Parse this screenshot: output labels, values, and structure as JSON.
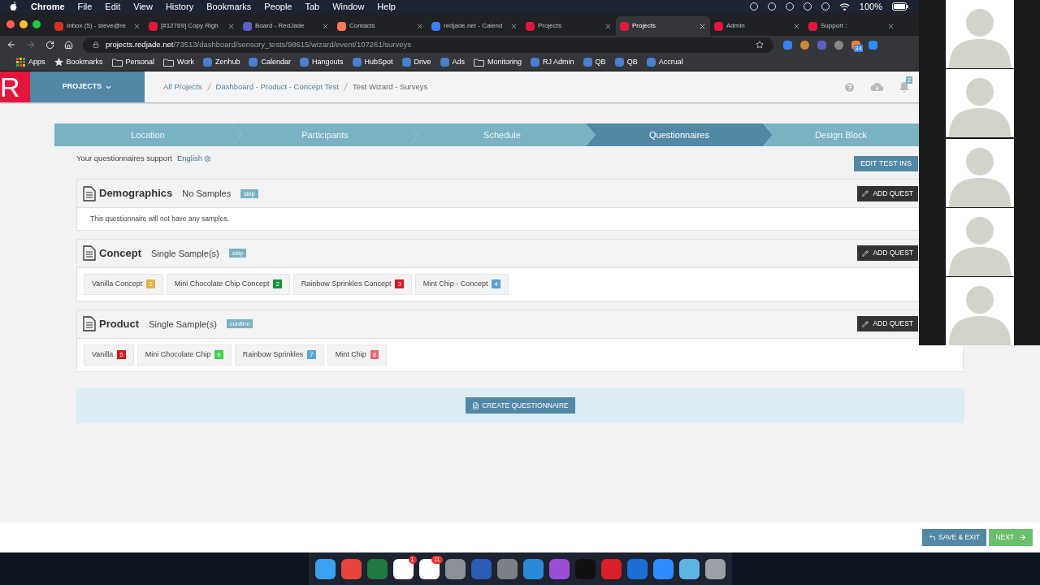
{
  "menu_bar": {
    "app": "Chrome",
    "items": [
      "File",
      "Edit",
      "View",
      "History",
      "Bookmarks",
      "People",
      "Tab",
      "Window",
      "Help"
    ],
    "battery": "100%"
  },
  "browser": {
    "tabs": [
      {
        "title": "Inbox (5) - steve@re",
        "selected": false,
        "color": "#d93025"
      },
      {
        "title": "[#12769] Copy Righ",
        "selected": false,
        "color": "#e3173e"
      },
      {
        "title": "Board - RedJade",
        "selected": false,
        "color": "#5c5fc4"
      },
      {
        "title": "Contacts",
        "selected": false,
        "color": "#ff7a59"
      },
      {
        "title": "redjade.net - Calend",
        "selected": false,
        "color": "#3b82f6"
      },
      {
        "title": "Projects",
        "selected": false,
        "color": "#e3173e"
      },
      {
        "title": "Projects",
        "selected": true,
        "color": "#e3173e"
      },
      {
        "title": "Admin",
        "selected": false,
        "color": "#e3173e"
      },
      {
        "title": "Support :",
        "selected": false,
        "color": "#e3173e"
      }
    ],
    "url_host": "projects.redjade.net",
    "url_path": "/73513/dashboard/sensory_tests/98615/wizard/event/107261/surveys",
    "extension_badge": "34",
    "bookmarks": [
      {
        "label": "Apps",
        "kind": "grid"
      },
      {
        "label": "Bookmarks",
        "kind": "star"
      },
      {
        "label": "Personal",
        "kind": "folder"
      },
      {
        "label": "Work",
        "kind": "folder"
      },
      {
        "label": "Zenhub",
        "kind": "site"
      },
      {
        "label": "Calendar",
        "kind": "site"
      },
      {
        "label": "Hangouts",
        "kind": "site"
      },
      {
        "label": "HubSpot",
        "kind": "site"
      },
      {
        "label": "Drive",
        "kind": "site"
      },
      {
        "label": "Ads",
        "kind": "site"
      },
      {
        "label": "Monitoring",
        "kind": "folder"
      },
      {
        "label": "RJ Admin",
        "kind": "site"
      },
      {
        "label": "QB",
        "kind": "site"
      },
      {
        "label": "QB",
        "kind": "site"
      },
      {
        "label": "Accrual",
        "kind": "site"
      }
    ]
  },
  "app_header": {
    "logo": "R",
    "projects_menu": "PROJECTS",
    "breadcrumbs": [
      "All Projects",
      "Dashboard - Product - Concept Test",
      "Test Wizard - Surveys"
    ],
    "notification_count": "2"
  },
  "wizard_steps": [
    {
      "label": "Location",
      "selected": false
    },
    {
      "label": "Participants",
      "selected": false
    },
    {
      "label": "Schedule",
      "selected": false
    },
    {
      "label": "Questionnaires",
      "selected": true
    },
    {
      "label": "Design Block",
      "selected": false
    }
  ],
  "language_note": {
    "text": "Your questionnaires support",
    "language": "English"
  },
  "edit_button": "EDIT TEST INS",
  "questionnaires": [
    {
      "title": "Demographics",
      "samples_type": "No Samples",
      "tag": "skip",
      "add_button": "ADD QUEST",
      "message": "This questionnaire will not have any samples."
    },
    {
      "title": "Concept",
      "samples_type": "Single Sample(s)",
      "tag": "skip",
      "add_button": "ADD QUEST",
      "samples": [
        {
          "name": "Vanilla Concept",
          "number": "1",
          "color": "#e8b04b"
        },
        {
          "name": "Mini Chocolate Chip Concept",
          "number": "2",
          "color": "#13923a"
        },
        {
          "name": "Rainbow Sprinkles Concept",
          "number": "3",
          "color": "#d9141b"
        },
        {
          "name": "Mint Chip - Concept",
          "number": "4",
          "color": "#5a9fd4"
        }
      ]
    },
    {
      "title": "Product",
      "samples_type": "Single Sample(s)",
      "tag": "confirm",
      "add_button": "ADD QUEST",
      "samples": [
        {
          "name": "Vanilla",
          "number": "5",
          "color": "#d9141b"
        },
        {
          "name": "Mini Chocolate Chip",
          "number": "6",
          "color": "#3fcf4f"
        },
        {
          "name": "Rainbow Sprinkles",
          "number": "7",
          "color": "#5aa6dc"
        },
        {
          "name": "Mint Chip",
          "number": "8",
          "color": "#e8646e"
        }
      ]
    }
  ],
  "create_button": "CREATE QUESTIONNAIRE",
  "footer_buttons": [
    {
      "label": "SAVE & EXIT",
      "kind": "back"
    },
    {
      "label": "NEXT",
      "kind": "next"
    }
  ],
  "dock": {
    "apps": [
      {
        "color": "#3aa0f0"
      },
      {
        "color": "#e8453c"
      },
      {
        "color": "#1f7a44"
      },
      {
        "color": "#ffffff",
        "badge": "1"
      },
      {
        "color": "#ffffff",
        "badge": "11"
      },
      {
        "color": "#8a8f98"
      },
      {
        "color": "#2b5cb8"
      },
      {
        "color": "#7c7f85"
      },
      {
        "color": "#2a8ad8"
      },
      {
        "color": "#9b4fd6"
      },
      {
        "color": "#111111"
      },
      {
        "color": "#d9202a"
      },
      {
        "color": "#1c6fd0"
      },
      {
        "color": "#2d8cff"
      },
      {
        "color": "#5fb4e6"
      },
      {
        "color": "#9aa0a6"
      }
    ]
  },
  "video_tiles": [
    {
      "kind": "avatar"
    },
    {
      "kind": "avatar"
    },
    {
      "kind": "avatar"
    },
    {
      "kind": "avatar"
    },
    {
      "kind": "avatar"
    }
  ]
}
